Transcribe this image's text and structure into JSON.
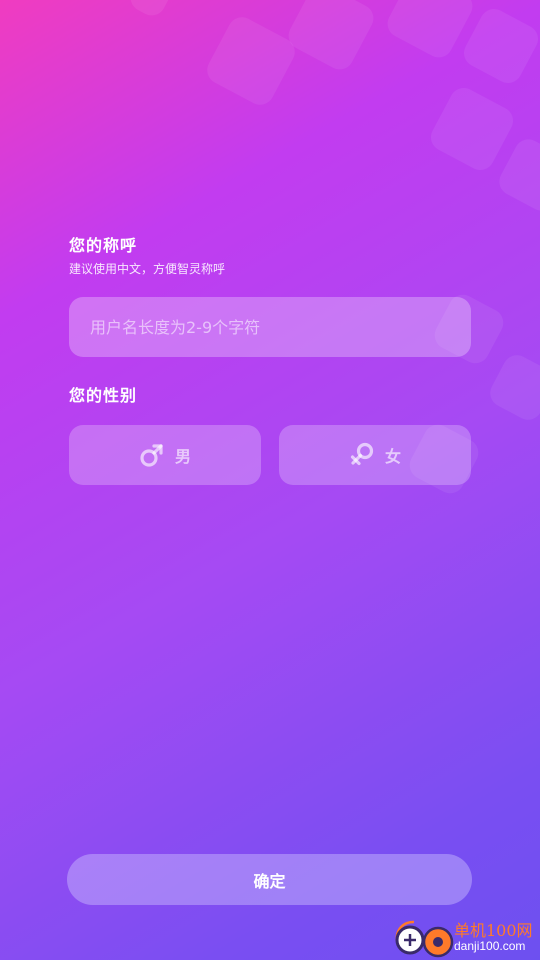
{
  "nickname_section": {
    "title": "您的称呼",
    "hint": "建议使用中文，方便智灵称呼",
    "input_value": "",
    "input_placeholder": "用户名长度为2-9个字符"
  },
  "gender_section": {
    "title": "您的性别",
    "options": [
      {
        "label": "男",
        "icon": "male-icon"
      },
      {
        "label": "女",
        "icon": "female-icon"
      }
    ]
  },
  "confirm_label": "确定",
  "watermark": {
    "name": "单机100网",
    "domain": "danji100.com",
    "colors": {
      "accent": "#ff7a2a",
      "logo_dark": "#3a2a6a"
    }
  },
  "colors": {
    "gradient_start": "#f03cc0",
    "gradient_end": "#6d50f0"
  }
}
